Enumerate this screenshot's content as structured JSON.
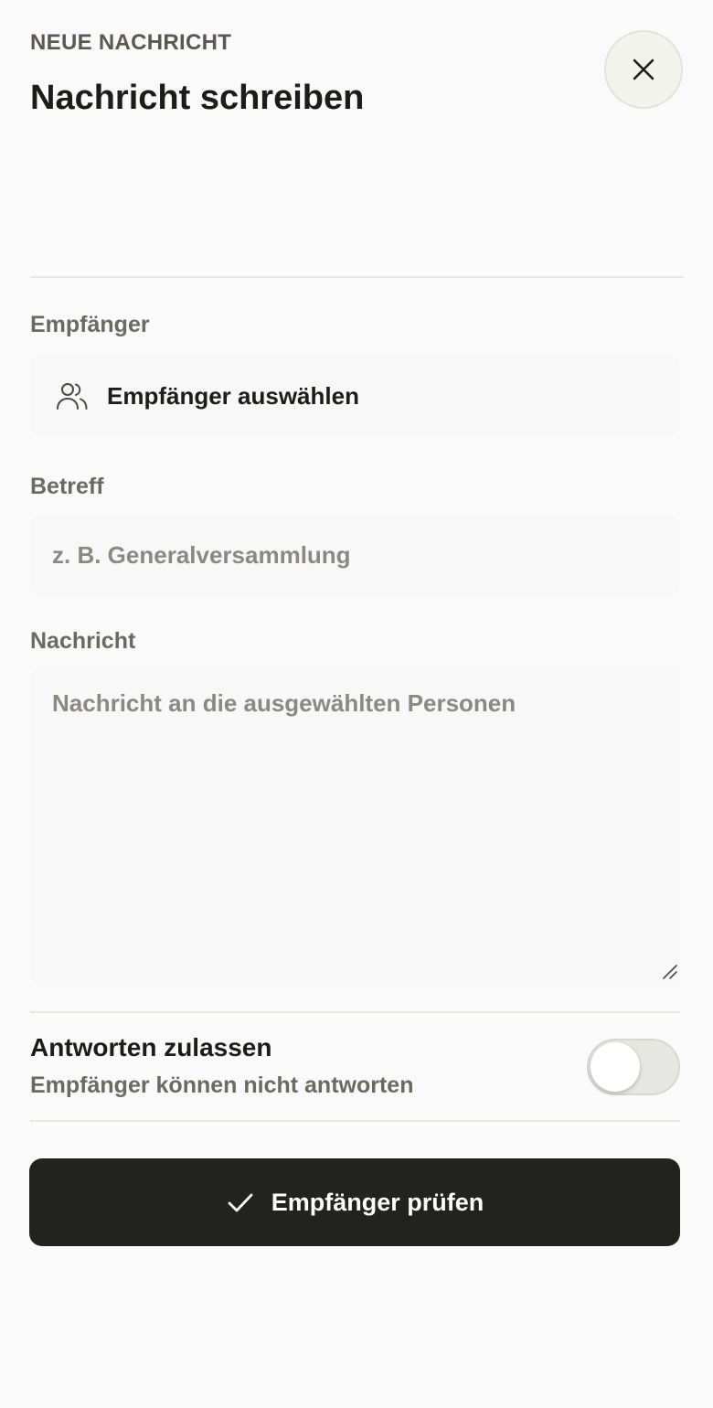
{
  "header": {
    "eyebrow": "NEUE NACHRICHT",
    "title": "Nachricht schreiben",
    "close_icon": "close-icon"
  },
  "form": {
    "recipients": {
      "label": "Empfänger",
      "button_text": "Empfänger auswählen",
      "icon": "people-icon"
    },
    "subject": {
      "label": "Betreff",
      "value": "",
      "placeholder": "z. B. Generalversammlung"
    },
    "message": {
      "label": "Nachricht",
      "value": "",
      "placeholder": "Nachricht an die ausgewählten Personen"
    },
    "allow_replies": {
      "title": "Antworten zulassen",
      "subtitle": "Empfänger können nicht antworten",
      "enabled": false
    }
  },
  "actions": {
    "primary_label": "Empfänger prüfen",
    "primary_icon": "check-icon"
  },
  "colors": {
    "primary_button": "#22221e",
    "muted_text": "#6a6962",
    "placeholder_text": "#8a8983",
    "background": "#fafafa"
  }
}
